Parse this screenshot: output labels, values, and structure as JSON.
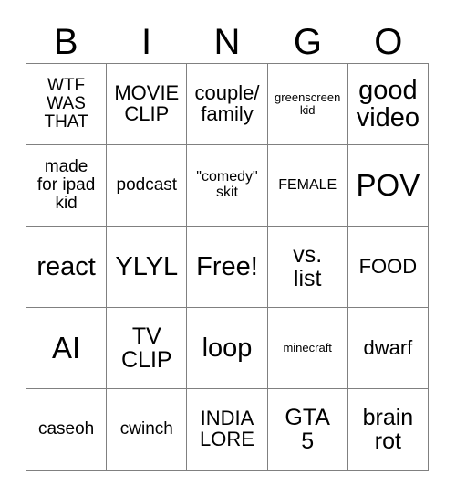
{
  "card": {
    "title": "BINGO",
    "header_letters": [
      "B",
      "I",
      "N",
      "G",
      "O"
    ],
    "free_space_label": "Free!",
    "grid_line_color": "#808080",
    "text_color": "#000000",
    "background_color": "#ffffff",
    "rows": [
      [
        {
          "text": "WTF\nWAS\nTHAT",
          "size": "fs-m"
        },
        {
          "text": "MOVIE\nCLIP",
          "size": "fs-ml"
        },
        {
          "text": "couple/\nfamily",
          "size": "fs-ml"
        },
        {
          "text": "greenscreen\nkid",
          "size": "fs-xs"
        },
        {
          "text": "good\nvideo",
          "size": "fs-xl"
        }
      ],
      [
        {
          "text": "made\nfor ipad\nkid",
          "size": "fs-m"
        },
        {
          "text": "podcast",
          "size": "fs-m"
        },
        {
          "text": "\"comedy\"\nskit",
          "size": "fs-s"
        },
        {
          "text": "FEMALE",
          "size": "fs-s"
        },
        {
          "text": "POV",
          "size": "fs-xxl"
        }
      ],
      [
        {
          "text": "react",
          "size": "fs-xl"
        },
        {
          "text": "YLYL",
          "size": "fs-xl"
        },
        {
          "text": "Free!",
          "size": "fs-xl"
        },
        {
          "text": "vs.\nlist",
          "size": "fs-l"
        },
        {
          "text": "FOOD",
          "size": "fs-ml"
        }
      ],
      [
        {
          "text": "AI",
          "size": "fs-xxl"
        },
        {
          "text": "TV\nCLIP",
          "size": "fs-l"
        },
        {
          "text": "loop",
          "size": "fs-xl"
        },
        {
          "text": "minecraft",
          "size": "fs-xs"
        },
        {
          "text": "dwarf",
          "size": "fs-ml"
        }
      ],
      [
        {
          "text": "caseoh",
          "size": "fs-m"
        },
        {
          "text": "cwinch",
          "size": "fs-m"
        },
        {
          "text": "INDIA\nLORE",
          "size": "fs-ml"
        },
        {
          "text": "GTA\n5",
          "size": "fs-l"
        },
        {
          "text": "brain\nrot",
          "size": "fs-l"
        }
      ]
    ]
  }
}
